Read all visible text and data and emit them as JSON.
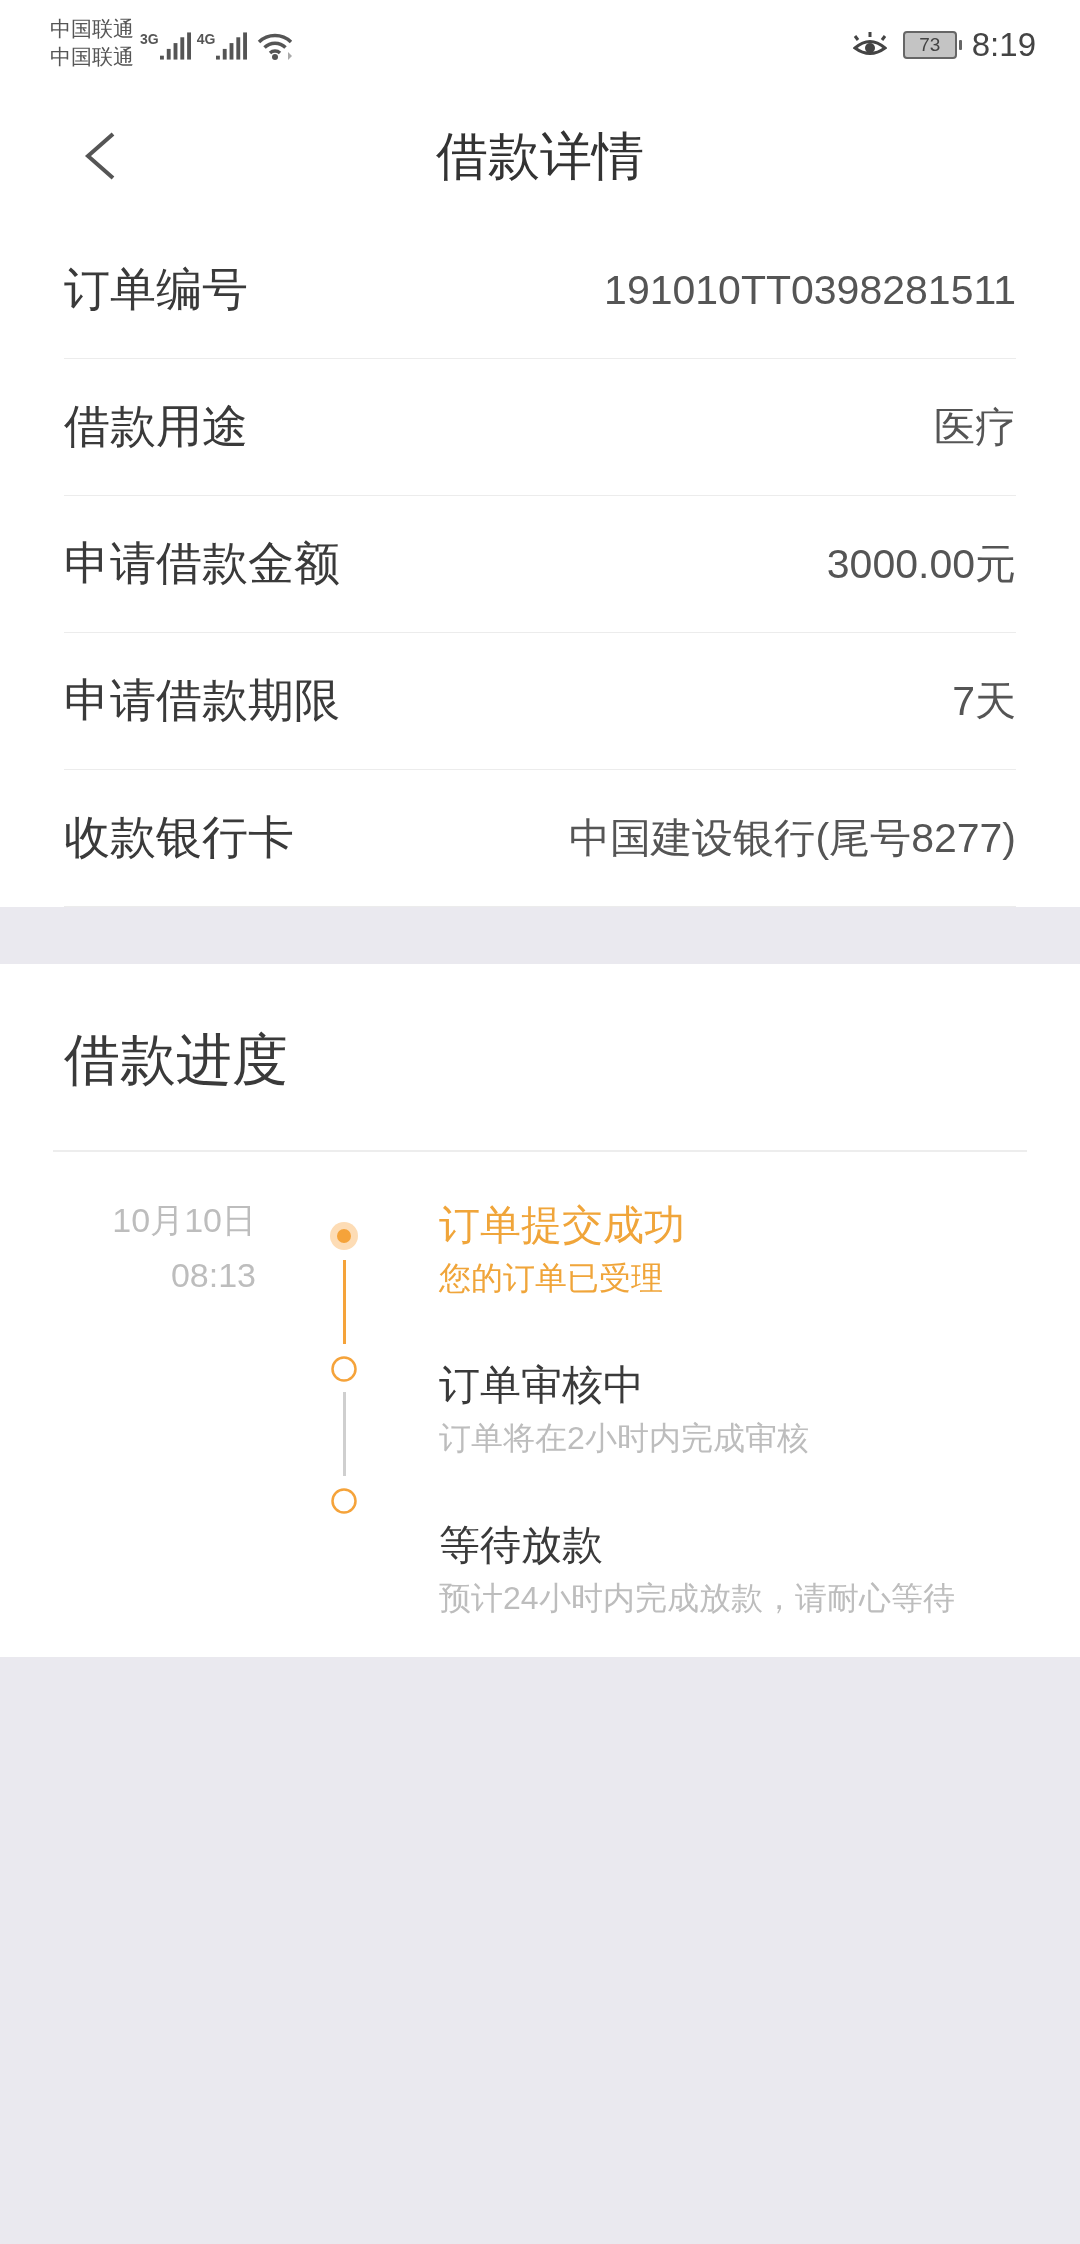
{
  "status_bar": {
    "carriers": [
      "中国联通",
      "中国联通"
    ],
    "networks": [
      "3G",
      "4G"
    ],
    "battery": "73",
    "time": "8:19"
  },
  "header": {
    "title": "借款详情"
  },
  "details": [
    {
      "label": "订单编号",
      "value": "191010TT0398281511"
    },
    {
      "label": "借款用途",
      "value": "医疗"
    },
    {
      "label": "申请借款金额",
      "value": "3000.00元"
    },
    {
      "label": "申请借款期限",
      "value": "7天"
    },
    {
      "label": "收款银行卡",
      "value": "中国建设银行(尾号8277)"
    }
  ],
  "progress": {
    "title": "借款进度",
    "steps": [
      {
        "date": "10月10日",
        "time": "08:13",
        "title": "订单提交成功",
        "note": "您的订单已受理",
        "completed": true
      },
      {
        "title": "订单审核中",
        "note": "订单将在2小时内完成审核",
        "completed": false
      },
      {
        "title": "等待放款",
        "note": "预计24小时内完成放款，请耐心等待",
        "completed": false
      }
    ]
  }
}
